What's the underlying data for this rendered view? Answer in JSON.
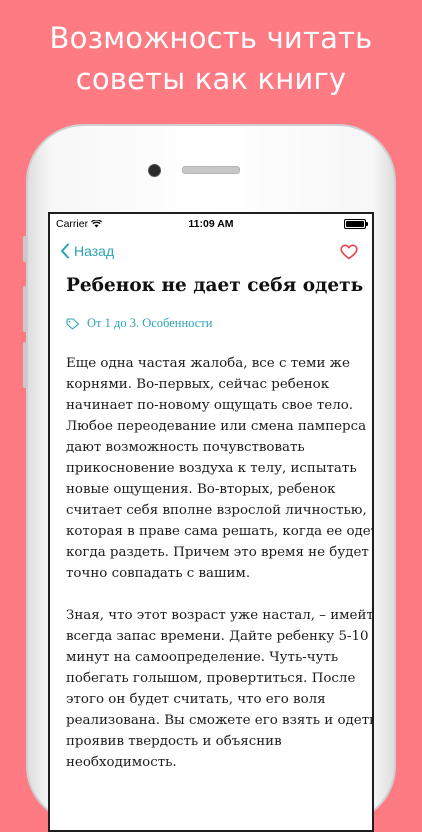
{
  "promo": {
    "headline_line1": "Возможность читать",
    "headline_line2": "советы как книгу"
  },
  "status_bar": {
    "carrier": "Carrier",
    "time": "11:09 AM"
  },
  "nav": {
    "back_label": "Назад",
    "back_icon": "chevron-left-icon",
    "favorite_icon": "heart-icon"
  },
  "article": {
    "title": "Ребенок не дает себя одеть",
    "category": "От 1 до 3. Особенности",
    "category_icon": "tag-icon",
    "paragraphs": [
      {
        "lines": [
          "Еще одна частая жалоба, все с теми же",
          "корнями. Во-первых, сейчас ребенок",
          "начинает по-новому ощущать свое тело.",
          "Любое переодевание или смена памперса",
          "дают возможность почувствовать",
          "прикосновение воздуха к телу, испытать",
          "новые ощущения. Во-вторых, ребенок",
          "считает себя вполне взрослой личностью,",
          "которая в праве сама решать, когда ее одеть,",
          "когда раздеть. Причем это время не будет",
          "точно совпадать с вашим."
        ]
      },
      {
        "lines": [
          "Зная, что этот возраст уже настал, – имейте",
          "всегда запас времени. Дайте ребенку 5-10",
          "минут на самоопределение. Чуть-чуть",
          "побегать голышом, провертиться. После",
          "этого он будет считать, что его воля",
          "реализована. Вы сможете его взять и одеть,",
          "проявив твердость и объяснив",
          "необходимость."
        ]
      }
    ]
  },
  "colors": {
    "background": "#ff7b84",
    "accent": "#2aa3b6",
    "heart": "#e8454f"
  }
}
